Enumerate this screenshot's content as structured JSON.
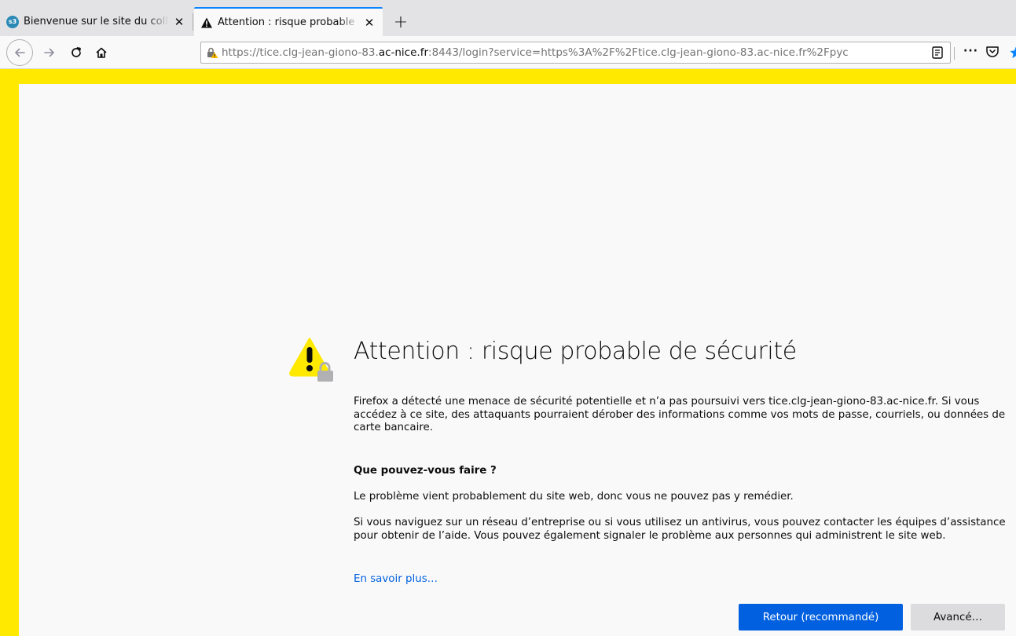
{
  "tabs": [
    {
      "title": "Bienvenue sur le site du collège",
      "favicon": "s3-favicon",
      "active": false
    },
    {
      "title": "Attention : risque probable de sécurité",
      "favicon": "warning-favicon",
      "active": true
    }
  ],
  "newtab_label": "+",
  "urlbar": {
    "scheme_prefix": "https://tice.clg-jean-giono-83.",
    "host_highlight": "ac-nice.fr",
    "rest": ":8443/login?service=https%3A%2F%2Ftice.clg-jean-giono-83.ac-nice.fr%2Fpyc"
  },
  "page_actions_label": "···",
  "page": {
    "title": "Attention : risque probable de sécurité",
    "intro": "Firefox a détecté une menace de sécurité potentielle et n’a pas poursuivi vers tice.clg-jean-giono-83.ac-nice.fr. Si vous accédez à ce site, des attaquants pourraient dérober des informations comme vos mots de passe, courriels, ou données de carte bancaire.",
    "heading": "Que pouvez-vous faire ?",
    "problem": "Le problème vient probablement du site web, donc vous ne pouvez pas y remédier.",
    "network": "Si vous naviguez sur un réseau d’entreprise ou si vous utilisez un antivirus, vous pouvez contacter les équipes d’assistance pour obtenir de l’aide. Vous pouvez également signaler le problème aux personnes qui administrent le site web.",
    "learn_more": "En savoir plus…",
    "buttons": {
      "back": "Retour (recommandé)",
      "advanced": "Avancé…"
    }
  },
  "colors": {
    "accent": "#0060df",
    "warning_frame": "#ffe900",
    "active_tab_line": "#0a84ff"
  }
}
